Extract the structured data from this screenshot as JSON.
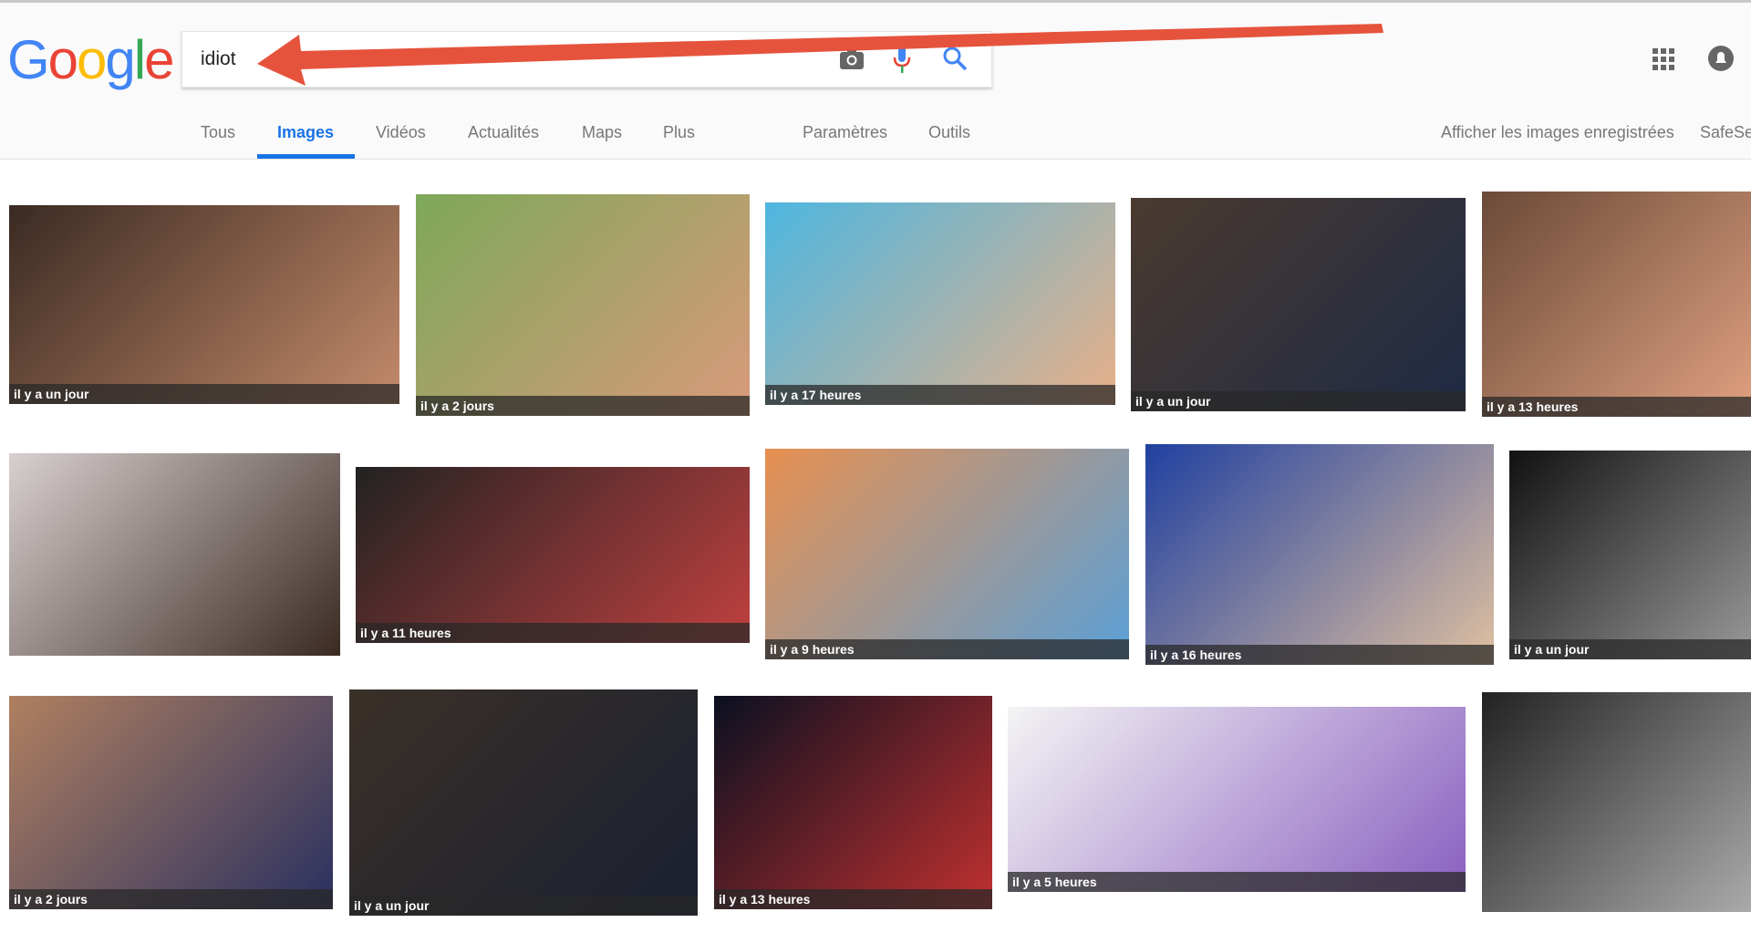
{
  "logo": "Google",
  "search": {
    "value": "idiot"
  },
  "tabs": [
    {
      "label": "Tous"
    },
    {
      "label": "Images"
    },
    {
      "label": "Vidéos"
    },
    {
      "label": "Actualités"
    },
    {
      "label": "Maps"
    },
    {
      "label": "Plus"
    },
    {
      "label": "Paramètres"
    },
    {
      "label": "Outils"
    }
  ],
  "right_links": {
    "saved": "Afficher les images enregistrées",
    "safesearch": "SafeSe"
  },
  "colors": {
    "accent": "#1a73e8",
    "arrow": "#e5533d"
  },
  "icons": [
    "camera-icon",
    "microphone-icon",
    "search-icon",
    "apps-grid-icon",
    "account-icon"
  ],
  "results": [
    {
      "label": "il y a un jour"
    },
    {
      "label": "il y a 2 jours"
    },
    {
      "label": "il y a 17 heures"
    },
    {
      "label": "il y a un jour"
    },
    {
      "label": "il y a 13 heures"
    },
    {
      "label": ""
    },
    {
      "label": "il y a 11 heures"
    },
    {
      "label": "il y a 9 heures"
    },
    {
      "label": "il y a 16 heures"
    },
    {
      "label": "il y a un jour"
    },
    {
      "label": "il y a 2 jours"
    },
    {
      "label": "il y a un jour"
    },
    {
      "label": "il y a 13 heures"
    },
    {
      "label": "il y a 5 heures"
    },
    {
      "label": ""
    }
  ]
}
